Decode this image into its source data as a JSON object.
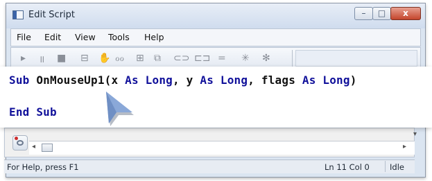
{
  "window": {
    "title": "Edit Script",
    "controls": {
      "minimize": "–",
      "maximize": "□",
      "close": "x"
    }
  },
  "menu": {
    "items": [
      {
        "label": "File"
      },
      {
        "label": "Edit"
      },
      {
        "label": "View"
      },
      {
        "label": "Tools"
      },
      {
        "label": "Help"
      }
    ]
  },
  "toolbar": {
    "icons": [
      {
        "name": "run-icon",
        "glyph": "▸"
      },
      {
        "name": "pause-icon",
        "glyph": "॥"
      },
      {
        "name": "stop-icon",
        "glyph": "■"
      },
      {
        "name": "dialog-icon",
        "glyph": "⊟"
      },
      {
        "name": "hand-icon",
        "glyph": "✋"
      },
      {
        "name": "watch-icon",
        "glyph": "ℴℴ"
      },
      {
        "name": "object-browser-icon",
        "glyph": "⊞"
      },
      {
        "name": "properties-icon",
        "glyph": "⧉"
      },
      {
        "name": "step-into-icon",
        "glyph": "⊂⊃"
      },
      {
        "name": "comment-icon",
        "glyph": "⊏⊐"
      },
      {
        "name": "equals-icon",
        "glyph": "="
      },
      {
        "name": "breakpoint-icon",
        "glyph": "✳"
      },
      {
        "name": "clear-breakpoint-icon",
        "glyph": "✻"
      }
    ]
  },
  "code": {
    "line1": [
      {
        "text": "Sub ",
        "style": "kw"
      },
      {
        "text": "OnMouseUp1(x ",
        "style": "id"
      },
      {
        "text": "As Long",
        "style": "kw"
      },
      {
        "text": ", y ",
        "style": "id"
      },
      {
        "text": "As Long",
        "style": "kw"
      },
      {
        "text": ", flags ",
        "style": "id"
      },
      {
        "text": "As Long",
        "style": "kw"
      },
      {
        "text": ")",
        "style": "id"
      }
    ],
    "line2": [
      {
        "text": "End Sub",
        "style": "kw"
      }
    ]
  },
  "statusbar": {
    "help": "For Help, press F1",
    "position": "Ln  11 Col  0",
    "mode": "Idle"
  },
  "colors": {
    "keyword": "#10109a",
    "identifier": "#111111",
    "pointer": "#8aa8d8"
  }
}
